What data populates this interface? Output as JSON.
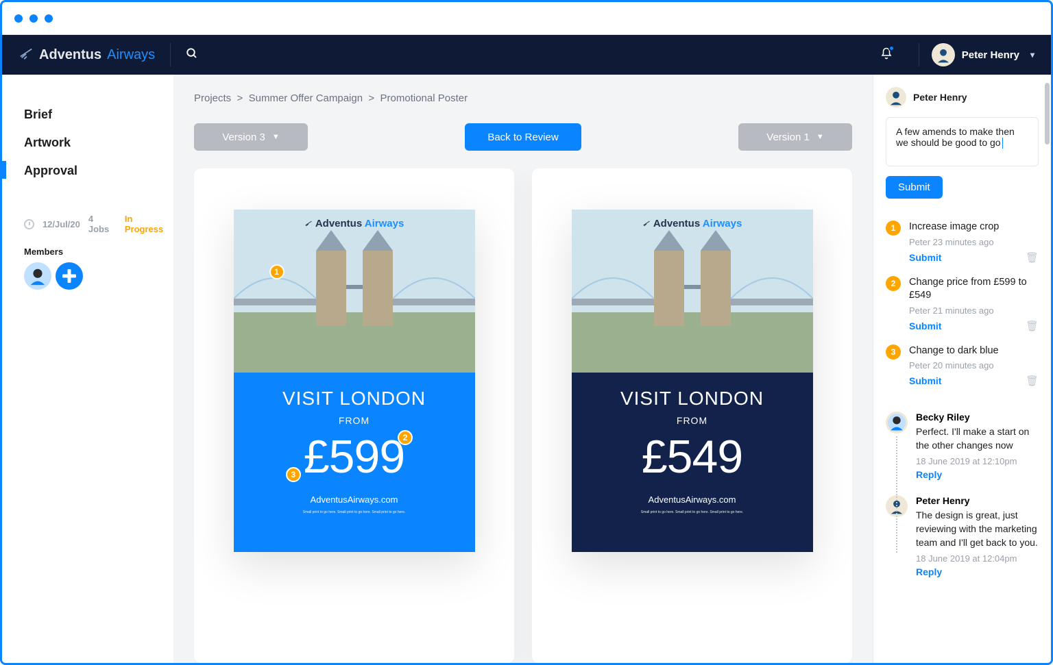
{
  "brand": {
    "part1": "Adventus",
    "part2": "Airways"
  },
  "user": {
    "name": "Peter Henry"
  },
  "sidebar": {
    "items": [
      {
        "label": "Brief"
      },
      {
        "label": "Artwork"
      },
      {
        "label": "Approval"
      }
    ],
    "date": "12/Jul/20",
    "jobs": "4 Jobs",
    "status": "In Progress",
    "members_label": "Members"
  },
  "breadcrumbs": [
    "Projects",
    "Summer Offer Campaign",
    "Promotional Poster"
  ],
  "controls": {
    "left": "Version 3",
    "center": "Back to Review",
    "right": "Version 1"
  },
  "poster_left": {
    "brand1": "Adventus",
    "brand2": "Airways",
    "title": "VISIT LONDON",
    "from": "FROM",
    "price": "£599",
    "url": "AdventusAirways.com",
    "small": "Small print to go here. Small print to go here. Small print to go here."
  },
  "poster_right": {
    "brand1": "Adventus",
    "brand2": "Airways",
    "title": "VISIT LONDON",
    "from": "FROM",
    "price": "£549",
    "url": "AdventusAirways.com",
    "small": "Small print to go here. Small print to go here. Small print to go here."
  },
  "markers": {
    "m1": "1",
    "m2": "2",
    "m3": "3"
  },
  "comment_panel": {
    "author": "Peter Henry",
    "draft": "A few amends to make then we should be good to go",
    "submit": "Submit"
  },
  "amends": [
    {
      "num": "1",
      "title": "Increase image crop",
      "meta": "Peter 23 minutes ago",
      "action": "Submit"
    },
    {
      "num": "2",
      "title": "Change price from £599 to £549",
      "meta": "Peter 21 minutes ago",
      "action": "Submit"
    },
    {
      "num": "3",
      "title": "Change to dark blue",
      "meta": "Peter 20 minutes ago",
      "action": "Submit"
    }
  ],
  "thread": [
    {
      "name": "Becky Riley",
      "text": "Perfect. I'll make a start on the other changes now",
      "meta": "18 June 2019 at 12:10pm",
      "reply": "Reply"
    },
    {
      "name": "Peter Henry",
      "text": "The design is great, just reviewing with the marketing team and I'll get back to you.",
      "meta": "18 June 2019 at 12:04pm",
      "reply": "Reply"
    }
  ]
}
